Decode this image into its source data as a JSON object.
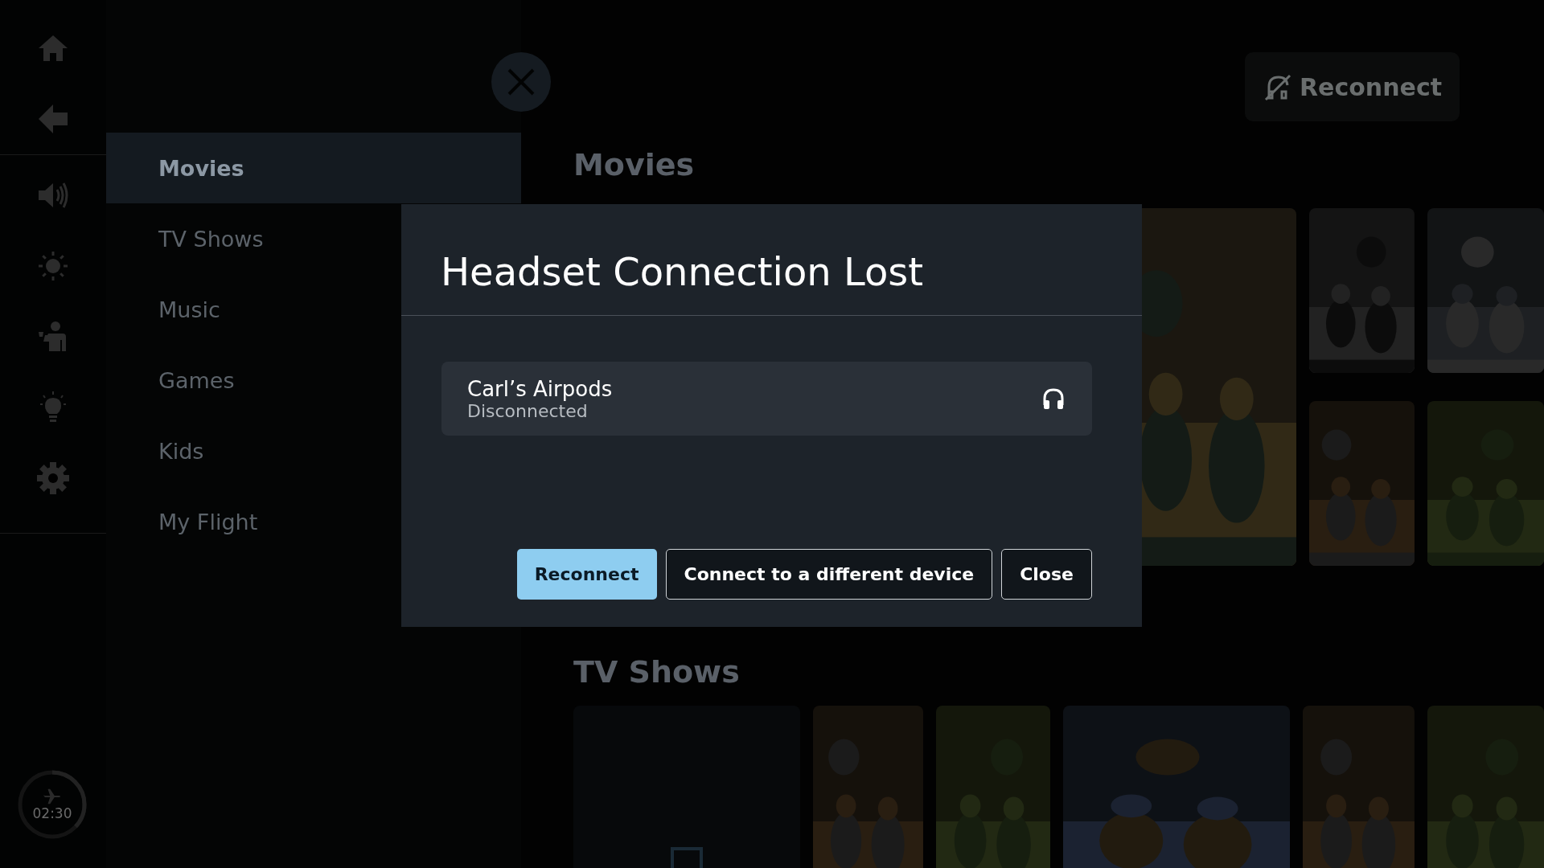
{
  "rail": {
    "items": [
      {
        "kind": "home"
      },
      {
        "kind": "back"
      },
      {
        "kind": "volume"
      },
      {
        "kind": "brightness"
      },
      {
        "kind": "attendant"
      },
      {
        "kind": "light"
      },
      {
        "kind": "settings"
      }
    ]
  },
  "flight_timer": {
    "time": "02:30",
    "level": 0.37
  },
  "menu": {
    "items": [
      {
        "label": "Movies",
        "selected": true
      },
      {
        "label": "TV Shows",
        "selected": false
      },
      {
        "label": "Music",
        "selected": false
      },
      {
        "label": "Games",
        "selected": false
      },
      {
        "label": "Kids",
        "selected": false
      },
      {
        "label": "My Flight",
        "selected": false
      }
    ]
  },
  "top_button": {
    "label": "Reconnect"
  },
  "sections": [
    {
      "title": "Movies",
      "columns": [
        {
          "posters": [
            {
              "kind": "picture"
            }
          ]
        },
        {
          "posters": [
            {
              "kind": "picture"
            },
            {
              "kind": "picture"
            }
          ]
        },
        {
          "posters": [
            {
              "kind": "picture"
            },
            {
              "kind": "picture"
            }
          ]
        }
      ]
    },
    {
      "title": "TV Shows",
      "columns": [
        {
          "posters": [
            {
              "kind": "placeholder"
            }
          ]
        },
        {
          "posters": [
            {
              "kind": "picture"
            }
          ]
        },
        {
          "posters": [
            {
              "kind": "picture"
            }
          ]
        },
        {
          "posters": [
            {
              "kind": "picture"
            }
          ]
        },
        {
          "posters": [
            {
              "kind": "picture"
            }
          ]
        },
        {
          "posters": [
            {
              "kind": "picture"
            }
          ]
        }
      ]
    }
  ],
  "dialog": {
    "title": "Headset Connection Lost",
    "device": {
      "name": "Carl’s Airpods",
      "status": "Disconnected"
    },
    "buttons": [
      {
        "label": "Reconnect",
        "kind": "primary"
      },
      {
        "label": "Connect to a different device",
        "kind": "outline"
      },
      {
        "label": "Close",
        "kind": "outline"
      }
    ]
  }
}
